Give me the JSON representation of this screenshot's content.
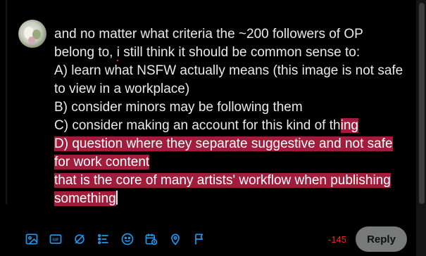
{
  "composer": {
    "lines": [
      "and no matter what criteria the ~200 followers of OP belong to, ",
      "i",
      " still think it should be common sense to:"
    ],
    "item_a": "A) learn what NSFW actually means (this image is not safe to view in a workplace)",
    "item_b": "B) consider minors may be following them",
    "item_c_plain": "C) consider making an account for this kind of th",
    "item_c_highlight": "ing",
    "item_d": "D) question where they separate suggestive and not safe for work content",
    "item_e": "that is the core of many artists' workflow when publishing something"
  },
  "toolbar": {
    "icons": [
      "image-icon",
      "gif-icon",
      "grok-icon",
      "poll-icon",
      "emoji-icon",
      "schedule-icon",
      "location-icon",
      "flag-icon"
    ]
  },
  "char_counter": "-145",
  "reply_label": "Reply",
  "colors": {
    "accent": "#1d9bf0",
    "highlight": "#a21d3b",
    "over_limit": "#f4212e",
    "reply_button": "#787a7a"
  }
}
